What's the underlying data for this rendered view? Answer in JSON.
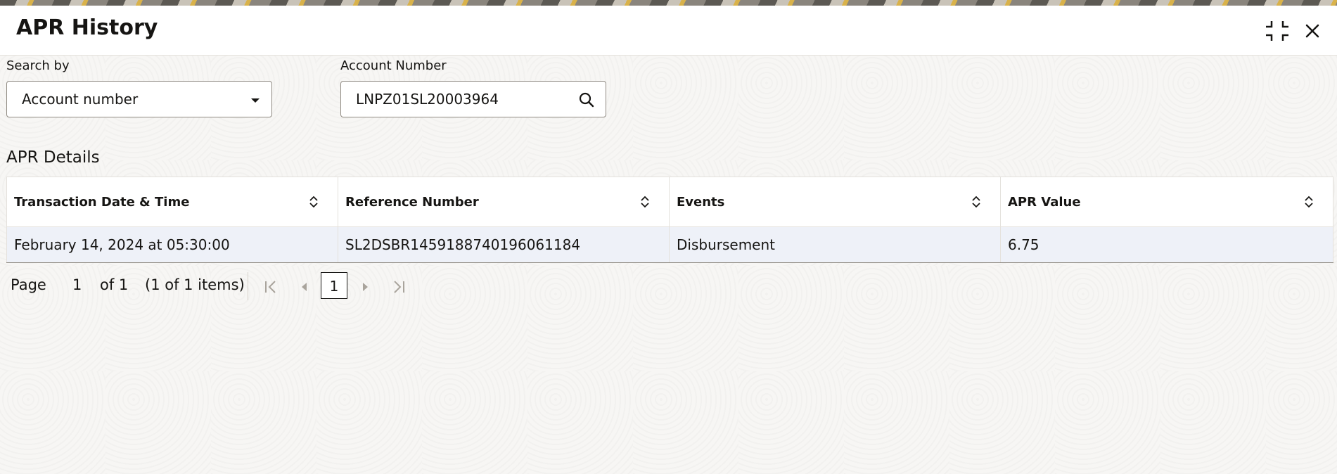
{
  "window": {
    "title": "APR History",
    "minimize_icon": "compress-icon",
    "close_icon": "close-icon"
  },
  "search": {
    "search_by_label": "Search by",
    "search_by_value": "Account number",
    "account_label": "Account Number",
    "account_value": "LNPZ01SL20003964"
  },
  "details": {
    "section_title": "APR Details",
    "columns": [
      "Transaction Date & Time",
      "Reference Number",
      "Events",
      "APR Value"
    ],
    "rows": [
      [
        "February 14, 2024 at 05:30:00",
        "SL2DSBR1459188740196061184",
        "Disbursement",
        "6.75"
      ]
    ]
  },
  "pager": {
    "page_label": "Page",
    "page_value": "1",
    "of_label": "of 1",
    "items_label": "(1 of 1 items)",
    "current_page": "1"
  },
  "colors": {
    "row_background": "#eef1f8",
    "border": "#e4e1dc",
    "text": "#161513"
  }
}
